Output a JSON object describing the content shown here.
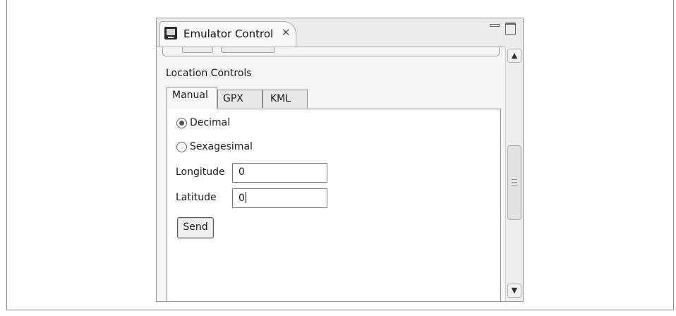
{
  "view": {
    "title": "Emulator Control",
    "close_glyph": "✕",
    "icon": "emulator-icon"
  },
  "location": {
    "section_label": "Location Controls",
    "tabs": [
      {
        "label": "Manual",
        "active": true
      },
      {
        "label": "GPX",
        "active": false
      },
      {
        "label": "KML",
        "active": false
      }
    ],
    "format_options": [
      {
        "label": "Decimal",
        "selected": true
      },
      {
        "label": "Sexagesimal",
        "selected": false
      }
    ],
    "longitude": {
      "label": "Longitude",
      "value": "0"
    },
    "latitude": {
      "label": "Latitude",
      "value": "0"
    },
    "send_label": "Send"
  },
  "scrollbar": {
    "up_glyph": "▲",
    "down_glyph": "▼"
  }
}
